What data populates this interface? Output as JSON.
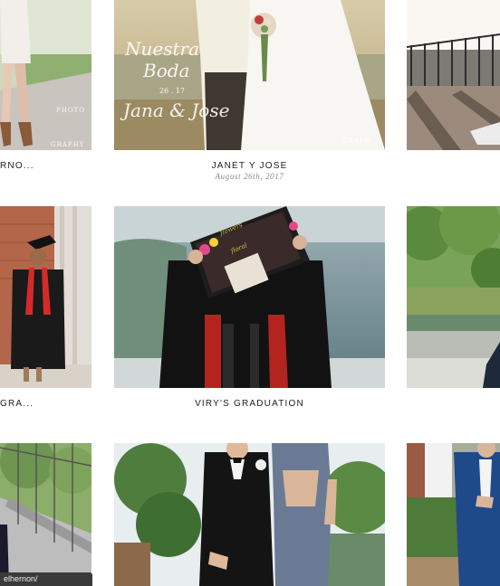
{
  "gallery": {
    "row1": {
      "left_caption": "RNO...",
      "center_title": "JANET Y JOSE",
      "center_date": "August 26th, 2017",
      "center_overlay": {
        "line1": "Nuestra",
        "line2": "Boda",
        "line3": "26 . 17",
        "line4": "Jana & Jose"
      },
      "watermark_left": "PHOTO",
      "watermark_left_bottom": "GRAPHY",
      "watermark_right": "GRAPH"
    },
    "row2": {
      "left_caption": "GRA...",
      "center_title": "VIRY'S GRADUATION"
    },
    "row3": {}
  },
  "status": {
    "url": "elhernon/"
  },
  "colors": {
    "background": "#ffffff",
    "caption": "#222222",
    "date": "#8a8a8a"
  }
}
